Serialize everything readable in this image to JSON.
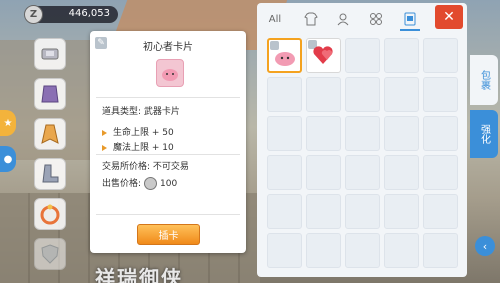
{
  "currency": {
    "value": "446,053",
    "icon": "zeny-coin-icon",
    "coin_glyph": "Z"
  },
  "bottom_text": "祥瑞御侠",
  "equipment_slots": [
    {
      "name": "weapon-slot",
      "icon": "card-weapon-icon"
    },
    {
      "name": "armor-slot",
      "icon": "armor-icon"
    },
    {
      "name": "cloak-slot",
      "icon": "cloak-icon"
    },
    {
      "name": "boots-slot",
      "icon": "boots-icon"
    },
    {
      "name": "accessory-slot",
      "icon": "ring-icon"
    },
    {
      "name": "extra-slot",
      "icon": "shield-icon"
    }
  ],
  "item_card": {
    "title": "初心者卡片",
    "tag": "✎",
    "type_line": "道具类型:  武器卡片",
    "stats": [
      "生命上限 + 50",
      "魔法上限 + 10"
    ],
    "trade_line": "交易所价格:  不可交易",
    "price_label": "出售价格:",
    "price_value": "100",
    "button_label": "插卡"
  },
  "inventory": {
    "tabs": [
      {
        "label": "All",
        "icon": null
      },
      {
        "label": "",
        "icon": "shirt-icon"
      },
      {
        "label": "",
        "icon": "person-icon"
      },
      {
        "label": "",
        "icon": "grid-icon"
      },
      {
        "label": "",
        "icon": "card-icon"
      }
    ],
    "active_tab": 4,
    "close_label": "✕",
    "rows": 6,
    "cols": 5,
    "items": [
      {
        "index": 0,
        "icon": "poring-card-icon",
        "selected": true
      },
      {
        "index": 1,
        "icon": "heart-card-icon",
        "selected": false
      }
    ]
  },
  "side_tabs": {
    "bag": "包裹",
    "enhance": "强化",
    "back": "‹"
  },
  "colors": {
    "accent": "#3b8fd9",
    "close": "#e24a2e",
    "button": "#f39a22",
    "selected": "#f4a21f"
  }
}
